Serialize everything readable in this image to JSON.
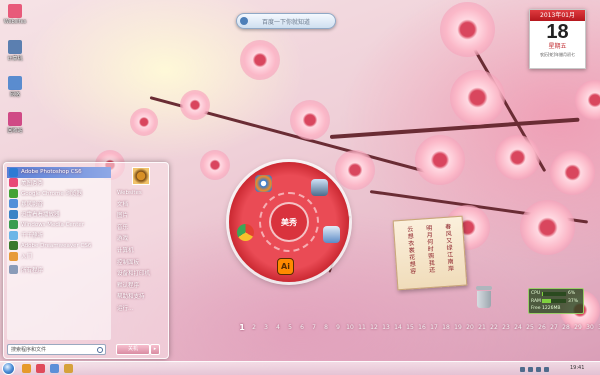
{
  "desktop": {
    "icons": [
      {
        "label": "Websites",
        "color": "#e85a7a"
      },
      {
        "label": "计算机",
        "color": "#5b7fb0"
      },
      {
        "label": "网络",
        "color": "#5a8ccf"
      },
      {
        "label": "回收站",
        "color": "#d04a86"
      }
    ]
  },
  "top_search": {
    "placeholder": "百度一下你就知道"
  },
  "calendar": {
    "month": "2013年01月",
    "day": "18",
    "weekday": "星期五",
    "lunar": "农历[蛇]年腊月初七"
  },
  "start_menu": {
    "programs": [
      {
        "label": "Adobe Photoshop CS6",
        "color": "#2f7bd3"
      },
      {
        "label": "美图秀秀",
        "color": "#e84a76"
      },
      {
        "label": "Google Chrome 浏览器",
        "color": "#45a336"
      },
      {
        "label": "暴风影音",
        "color": "#5390d9"
      },
      {
        "label": "迅雷看看播放器",
        "color": "#3b83c6"
      },
      {
        "label": "Windows Media Center",
        "color": "#3a9c50"
      },
      {
        "label": "千千静听",
        "color": "#6cb5e7"
      },
      {
        "label": "Adobe Dreamweaver CS6",
        "color": "#3a7a2c"
      },
      {
        "label": "入门",
        "color": "#e79b3a"
      }
    ],
    "all_programs": "所有程序",
    "search_placeholder": "搜索程序和文件",
    "right_links": [
      "Websites",
      "文档",
      "图片",
      "音乐",
      "游戏",
      "计算机",
      "控制面板",
      "设备和打印机",
      "默认程序",
      "帮助和支持",
      "运行..."
    ],
    "shutdown_label": "关机",
    "shutdown_arrow": "▸"
  },
  "launcher": {
    "center_label": "美秀",
    "icons": [
      {
        "name": "meitu",
        "color": "#2e7bd6"
      },
      {
        "name": "computer",
        "color": "#4b6b8c"
      },
      {
        "name": "chrome",
        "color": "#4caf50"
      },
      {
        "name": "network",
        "color": "#5b8bc6"
      },
      {
        "name": "illustrator",
        "label": "Ai"
      }
    ]
  },
  "tag_card": {
    "col1": "春风又绿江南岸",
    "col2": "明月何时照我还",
    "col3": "云想衣裳花想容"
  },
  "system_monitor": {
    "cpu_label": "CPU",
    "cpu_value": "6%",
    "cpu_fraction": 0.06,
    "ram_label": "RAM",
    "ram_value": "37%",
    "ram_fraction": 0.37,
    "free_label": "Free",
    "free_value": "1226MB"
  },
  "day_strip": {
    "days": [
      "1",
      "2",
      "3",
      "4",
      "5",
      "6",
      "7",
      "8",
      "9",
      "10",
      "11",
      "12",
      "13",
      "14",
      "15",
      "16",
      "17",
      "18",
      "19",
      "20",
      "21",
      "22",
      "23",
      "24",
      "25",
      "26",
      "27",
      "28",
      "29",
      "30",
      "31"
    ],
    "today": "1"
  },
  "taskbar": {
    "clock": "19:41",
    "apps": [
      "#e69a2a",
      "#e04a5a",
      "#5b8fd8",
      "#d6a23a"
    ]
  }
}
